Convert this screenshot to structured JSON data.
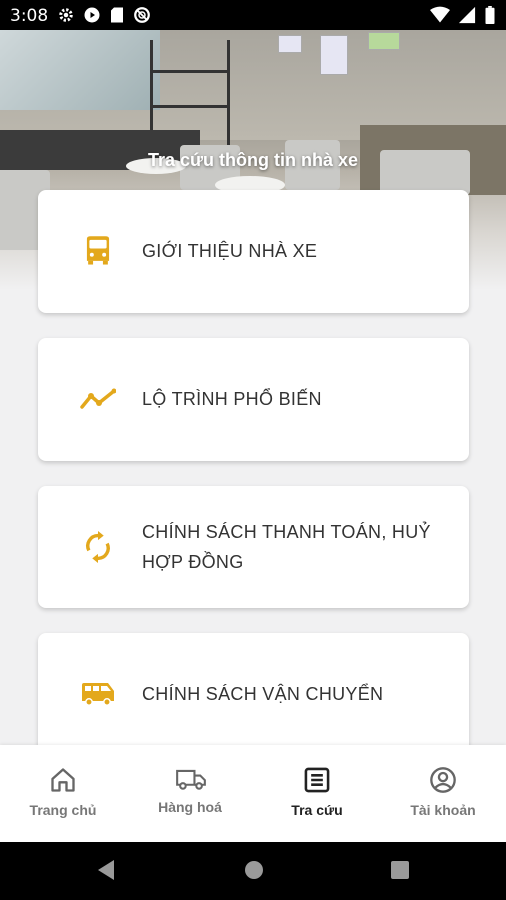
{
  "status_bar": {
    "time": "3:08"
  },
  "hero": {
    "title": "Tra cứu thông tin nhà xe"
  },
  "cards": [
    {
      "label": "GIỚI THIỆU NHÀ XE",
      "icon": "bus-icon"
    },
    {
      "label": "LỘ TRÌNH PHỔ BIẾN",
      "icon": "trending-route-icon"
    },
    {
      "label": "CHÍNH SÁCH THANH TOÁN, HUỶ HỢP ĐỒNG",
      "icon": "sync-icon"
    },
    {
      "label": "CHÍNH SÁCH VẬN CHUYỂN",
      "icon": "van-icon"
    }
  ],
  "bottom_nav": {
    "items": [
      {
        "label": "Trang chủ",
        "icon": "home-icon",
        "active": false
      },
      {
        "label": "Hàng hoá",
        "icon": "truck-icon",
        "active": false
      },
      {
        "label": "Tra cứu",
        "icon": "list-icon",
        "active": true
      },
      {
        "label": "Tài khoản",
        "icon": "account-icon",
        "active": false
      }
    ]
  },
  "colors": {
    "accent": "#e3a81c",
    "text": "#333333",
    "nav_inactive": "#777777",
    "nav_active": "#222222"
  }
}
